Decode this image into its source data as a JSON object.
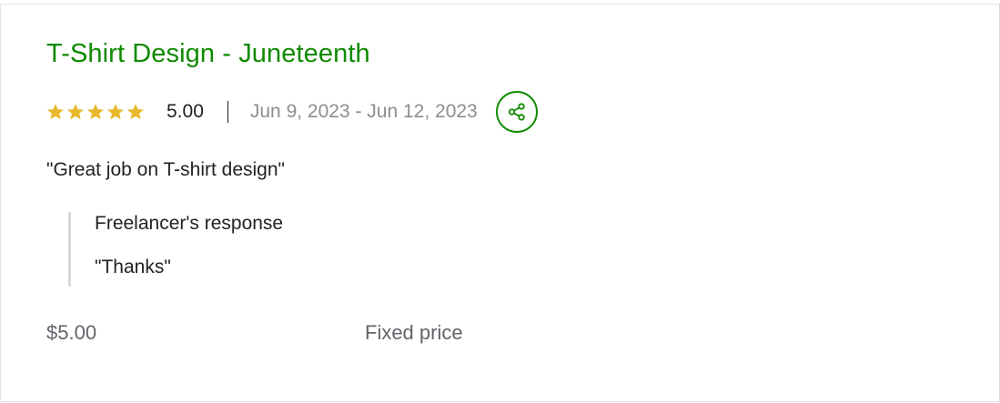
{
  "review": {
    "title": "T-Shirt Design - Juneteenth",
    "rating": {
      "value": "5.00",
      "stars_filled": 5,
      "stars_total": 5,
      "star_color": "#e7b92b"
    },
    "dates": "Jun 9, 2023 - Jun 12, 2023",
    "share_icon": "share-icon",
    "comment": "\"Great job on T-shirt design\"",
    "response": {
      "heading": "Freelancer's response",
      "text": "\"Thanks\""
    },
    "price": "$5.00",
    "price_type": "Fixed price"
  },
  "colors": {
    "accent": "#108a00",
    "text": "#222222",
    "muted": "#8e8e8e"
  }
}
